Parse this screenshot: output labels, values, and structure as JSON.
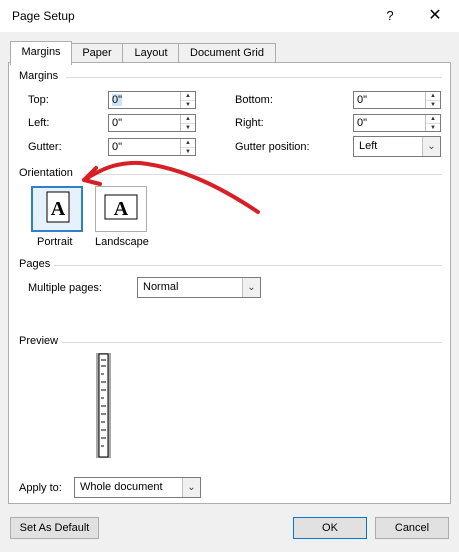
{
  "title": "Page Setup",
  "titlebar": {
    "help": "?",
    "close": "✕"
  },
  "tabs": [
    {
      "label": "Margins"
    },
    {
      "label": "Paper"
    },
    {
      "label": "Layout"
    },
    {
      "label": "Document Grid"
    }
  ],
  "margins": {
    "header": "Margins",
    "top": {
      "label": "Top:",
      "value": "0\""
    },
    "left": {
      "label": "Left:",
      "value": "0\""
    },
    "gutter": {
      "label": "Gutter:",
      "value": "0\""
    },
    "bottom": {
      "label": "Bottom:",
      "value": "0\""
    },
    "right": {
      "label": "Right:",
      "value": "0\""
    },
    "gutter_position": {
      "label": "Gutter position:",
      "value": "Left"
    }
  },
  "orientation": {
    "header": "Orientation",
    "portrait": "Portrait",
    "landscape": "Landscape",
    "selected": "Portrait",
    "glyph": "A"
  },
  "pages": {
    "header": "Pages",
    "multiple_pages_label": "Multiple pages:",
    "multiple_pages_value": "Normal"
  },
  "preview": {
    "header": "Preview"
  },
  "apply_to": {
    "label": "Apply to:",
    "value": "Whole document"
  },
  "buttons": {
    "set_default": "Set As Default",
    "ok": "OK",
    "cancel": "Cancel"
  },
  "colors": {
    "selection_border": "#2f80c7",
    "annotation_arrow": "#d61f26"
  }
}
